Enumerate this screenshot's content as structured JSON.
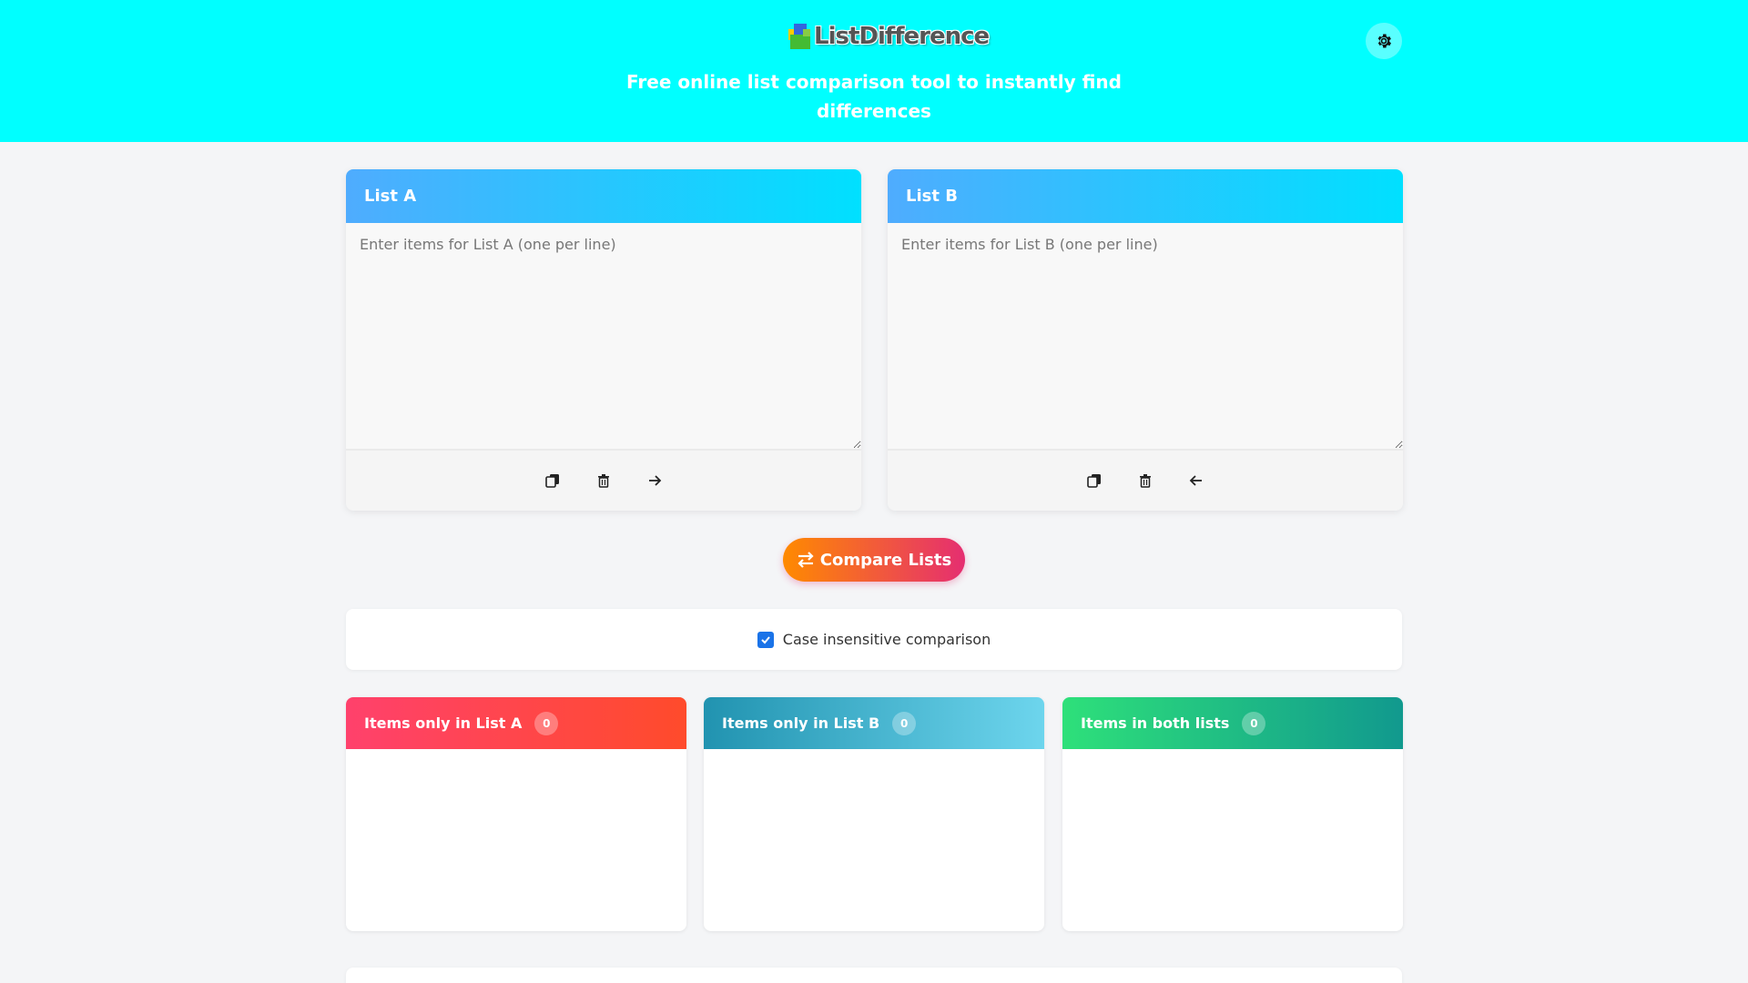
{
  "header": {
    "logo_text": "ListDifference",
    "tagline": "Free online list comparison tool to instantly find differences",
    "theme_toggle_icon": "gear-icon"
  },
  "list_a": {
    "title": "List A",
    "placeholder": "Enter items for List A (one per line)",
    "value": "",
    "tools": [
      "copy-icon",
      "trash-icon",
      "arrow-right-icon"
    ]
  },
  "list_b": {
    "title": "List B",
    "placeholder": "Enter items for List B (one per line)",
    "value": "",
    "tools": [
      "copy-icon",
      "trash-icon",
      "arrow-left-icon"
    ]
  },
  "compare": {
    "label": "Compare Lists",
    "icon": "swap-icon"
  },
  "options": {
    "case_insensitive_label": "Case insensitive comparison",
    "case_insensitive_checked": true
  },
  "results": {
    "only_a": {
      "title": "Items only in List A",
      "count": "0"
    },
    "only_b": {
      "title": "Items only in List B",
      "count": "0"
    },
    "both": {
      "title": "Items in both lists",
      "count": "0"
    }
  },
  "colors": {
    "header_bg": "#00ffff",
    "panel_header_gradient": [
      "#4facfe",
      "#00e0ff"
    ],
    "compare_gradient": [
      "#ff8a00",
      "#e52e71"
    ],
    "only_a_gradient": [
      "#ff416c",
      "#ff4b2b"
    ],
    "only_b_gradient": [
      "#2193b0",
      "#6dd5ed"
    ],
    "both_gradient": [
      "#2ee07a",
      "#11998e"
    ],
    "checkbox": "#1a73e8"
  }
}
